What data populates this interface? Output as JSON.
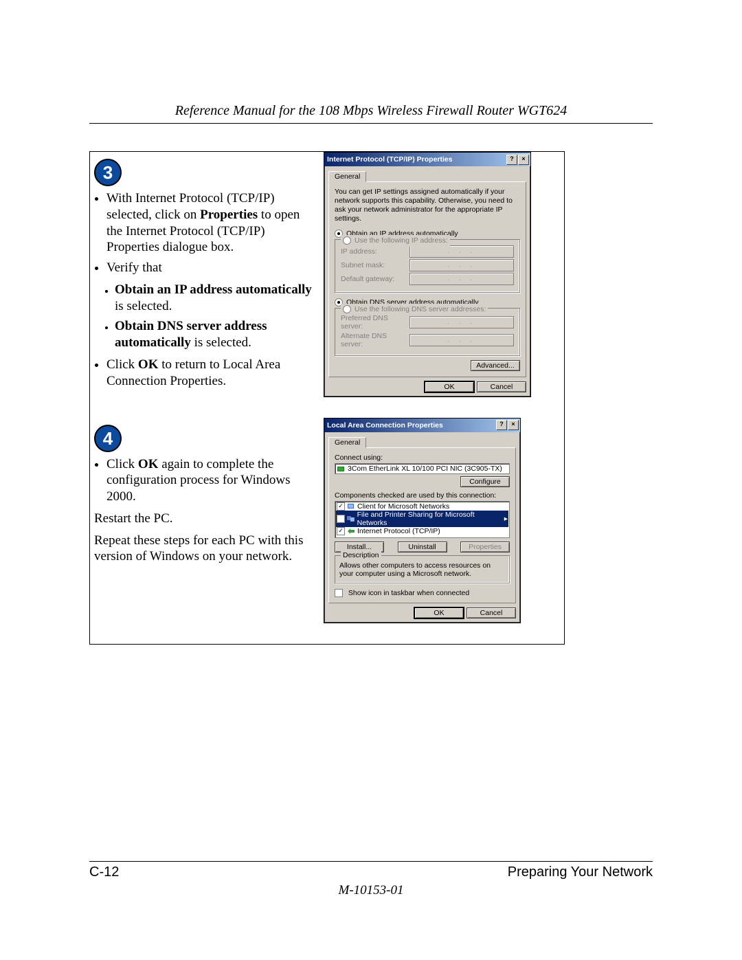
{
  "header": {
    "title": "Reference Manual for the 108 Mbps Wireless Firewall Router WGT624"
  },
  "step3": {
    "number": "3",
    "bullets": {
      "b1a": "With Internet Protocol (TCP/IP) selected, click on ",
      "b1_bold": "Properties",
      "b1b": " to open the Internet Protocol (TCP/IP) Properties dialogue box.",
      "b2": "Verify that",
      "sub1_bold": "Obtain an IP address automatically",
      "sub1_tail": " is selected.",
      "sub2_bold": "Obtain DNS server address automatically",
      "sub2_tail": " is selected.",
      "b3a": "Click ",
      "b3_bold": "OK",
      "b3b": " to return to Local Area Connection Properties."
    }
  },
  "step4": {
    "number": "4",
    "bullet_a": "Click ",
    "bullet_bold": "OK",
    "bullet_b": " again to complete the configuration process for Windows 2000.",
    "p1": "Restart the PC.",
    "p2": "Repeat these steps for each PC with this version of Windows on your network."
  },
  "dialog1": {
    "title": "Internet Protocol (TCP/IP) Properties",
    "tab": "General",
    "desc": "You can get IP settings assigned automatically if your network supports this capability. Otherwise, you need to ask your network administrator for the appropriate IP settings.",
    "r1": "Obtain an IP address automatically",
    "r2": "Use the following IP address:",
    "ip_label": "IP address:",
    "subnet_label": "Subnet mask:",
    "gw_label": "Default gateway:",
    "r3": "Obtain DNS server address automatically",
    "r4": "Use the following DNS server addresses:",
    "pref_label": "Preferred DNS server:",
    "alt_label": "Alternate DNS server:",
    "advanced": "Advanced...",
    "ok": "OK",
    "cancel": "Cancel"
  },
  "dialog2": {
    "title": "Local Area Connection Properties",
    "tab": "General",
    "connect_using": "Connect using:",
    "adapter": "3Com EtherLink XL 10/100 PCI NIC (3C905-TX)",
    "configure": "Configure",
    "components_label": "Components checked are used by this connection:",
    "item1": "Client for Microsoft Networks",
    "item2": "File and Printer Sharing for Microsoft Networks",
    "item3": "Internet Protocol (TCP/IP)",
    "install": "Install...",
    "uninstall": "Uninstall",
    "properties": "Properties",
    "desc_legend": "Description",
    "desc": "Allows other computers to access resources on your computer using a Microsoft network.",
    "show_icon": "Show icon in taskbar when connected",
    "ok": "OK",
    "cancel": "Cancel"
  },
  "footer": {
    "left": "C-12",
    "right": "Preparing Your Network",
    "mid": "M-10153-01"
  }
}
